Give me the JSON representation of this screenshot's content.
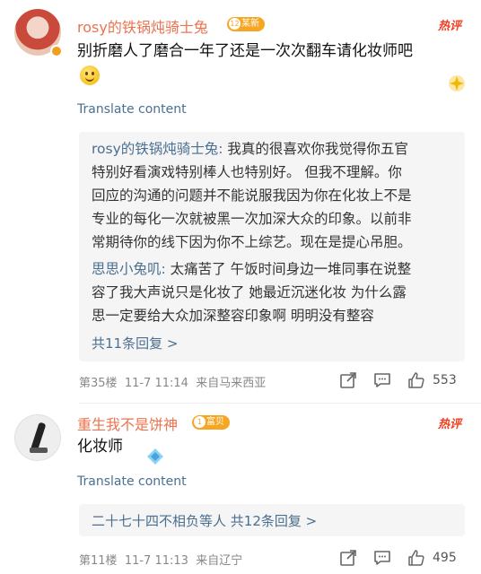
{
  "comments": [
    {
      "username": "rosy的铁锅炖骑士兔",
      "level_badge": "某新",
      "level_num": "12",
      "hot_label": "热评",
      "content_line1": "别折磨人了磨合一年了还是一次次翻车请化妆师吧",
      "translate": "Translate content",
      "replies": {
        "lines": [
          {
            "name": "rosy的铁锅炖骑士兔:",
            "text": " 我真的很喜欢你我觉得你五官"
          },
          {
            "name": "",
            "text": "特别好看演戏特别棒人也特别好。  但我不理解。你"
          },
          {
            "name": "",
            "text": "回应的沟通的问题并不能说服我因为你在化妆上不是"
          },
          {
            "name": "",
            "text": "专业的每化一次就被黑一次加深大众的印象。以前非"
          },
          {
            "name": "",
            "text": "常期待你的线下因为你不上综艺。现在是提心吊胆。"
          },
          {
            "name": "思思小兔叽:",
            "text": " 太痛苦了 午饭时间身边一堆同事在说整"
          },
          {
            "name": "",
            "text": "容了我大声说只是化妆了 她最近沉迷化妆  为什么露"
          },
          {
            "name": "",
            "text": "思一定要给大众加深整容印象啊 明明没有整容"
          }
        ],
        "more": "共11条回复 >"
      },
      "floor": "第35楼",
      "date": "11-7 11:14",
      "location": "来自马来西亚",
      "likes": "553"
    },
    {
      "username": "重生我不是饼神",
      "level_badge": "富贝",
      "level_num": "1",
      "hot_label": "热评",
      "content_line1": "化妆师",
      "translate": "Translate content",
      "replies": {
        "lines": [],
        "more_name": "二十七十四不相负",
        "more": "等人 共12条回复 >"
      },
      "floor": "第11楼",
      "date": "11-7 11:13",
      "location": "来自辽宁",
      "likes": "495"
    }
  ],
  "colors": {
    "username": "#eb7350",
    "link": "#4a6f90",
    "hot": "#f04020",
    "badge": "#f5a623"
  },
  "icons": [
    "share-icon",
    "comment-icon",
    "like-icon",
    "smile-emoji-icon",
    "sparkle-icon"
  ]
}
